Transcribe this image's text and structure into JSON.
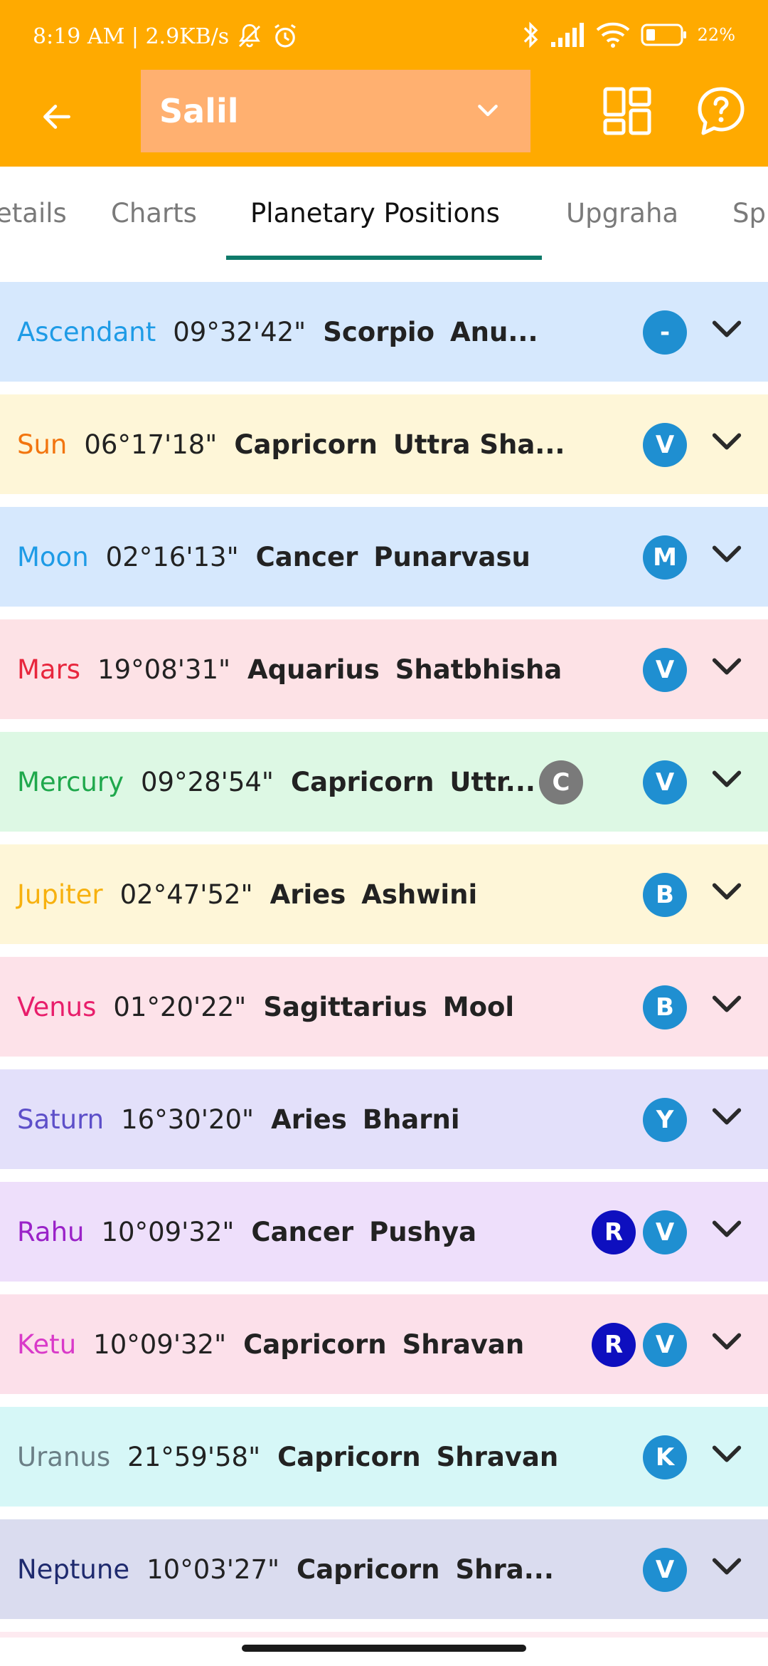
{
  "status_bar": {
    "time_and_speed": "8:19 AM | 2.9KB/s",
    "battery_percent": "22%",
    "icons": [
      "muted-bell-icon",
      "alarm-icon",
      "bluetooth-icon",
      "signal-icon",
      "wifi-icon",
      "battery-icon"
    ]
  },
  "app_bar": {
    "profile_name": "Salil",
    "icons": [
      "back-arrow-icon",
      "chevron-down-icon",
      "grid-layout-icon",
      "help-icon"
    ]
  },
  "tabs": [
    {
      "label": "etails"
    },
    {
      "label": "Charts"
    },
    {
      "label": "Planetary Positions",
      "active": true
    },
    {
      "label": "Upgraha"
    },
    {
      "label": "Sp"
    }
  ],
  "rows": [
    {
      "planet": "Ascendant",
      "degree": "09°32'42\"",
      "sign": "Scorpio",
      "nakshatra": "Anu...",
      "planet_color": "#1E9BE6",
      "bg": "#D6E8FD",
      "badges": [
        {
          "text": "-",
          "color": "#1F8FD1"
        }
      ]
    },
    {
      "planet": "Sun",
      "degree": "06°17'18\"",
      "sign": "Capricorn",
      "nakshatra": "Uttra Sha...",
      "planet_color": "#F2750F",
      "bg": "#FEF6D8",
      "badges": [
        {
          "text": "V",
          "color": "#1F8FD1"
        }
      ]
    },
    {
      "planet": "Moon",
      "degree": "02°16'13\"",
      "sign": "Cancer",
      "nakshatra": "Punarvasu",
      "planet_color": "#1E9BE6",
      "bg": "#D6E8FD",
      "badges": [
        {
          "text": "M",
          "color": "#1F8FD1"
        }
      ]
    },
    {
      "planet": "Mars",
      "degree": "19°08'31\"",
      "sign": "Aquarius",
      "nakshatra": "Shatbhisha",
      "planet_color": "#E8263D",
      "bg": "#FDE2E6",
      "badges": [
        {
          "text": "V",
          "color": "#1F8FD1"
        }
      ]
    },
    {
      "planet": "Mercury",
      "degree": "09°28'54\"",
      "sign": "Capricorn",
      "nakshatra": "Uttr...",
      "planet_color": "#1FA84C",
      "bg": "#DDF8E4",
      "badges": [
        {
          "text": "C",
          "color": "#7A7A7A"
        },
        {
          "text": "V",
          "color": "#1F8FD1"
        }
      ]
    },
    {
      "planet": "Jupiter",
      "degree": "02°47'52\"",
      "sign": "Aries",
      "nakshatra": "Ashwini",
      "planet_color": "#F7B10F",
      "bg": "#FEF6D8",
      "badges": [
        {
          "text": "B",
          "color": "#1F8FD1"
        }
      ]
    },
    {
      "planet": "Venus",
      "degree": "01°20'22\"",
      "sign": "Sagittarius",
      "nakshatra": "Mool",
      "planet_color": "#E81E6B",
      "bg": "#FDE2E9",
      "badges": [
        {
          "text": "B",
          "color": "#1F8FD1"
        }
      ]
    },
    {
      "planet": "Saturn",
      "degree": "16°30'20\"",
      "sign": "Aries",
      "nakshatra": "Bharni",
      "planet_color": "#5D4FC9",
      "bg": "#E3E0FA",
      "badges": [
        {
          "text": "Y",
          "color": "#1F8FD1"
        }
      ]
    },
    {
      "planet": "Rahu",
      "degree": "10°09'32\"",
      "sign": "Cancer",
      "nakshatra": "Pushya",
      "planet_color": "#9A22C8",
      "bg": "#EEDFFB",
      "badges": [
        {
          "text": "R",
          "color": "#0E0FBF"
        },
        {
          "text": "V",
          "color": "#1F8FD1"
        }
      ]
    },
    {
      "planet": "Ketu",
      "degree": "10°09'32\"",
      "sign": "Capricorn",
      "nakshatra": "Shravan",
      "planet_color": "#D93AC9",
      "bg": "#FCE0EA",
      "badges": [
        {
          "text": "R",
          "color": "#0E0FBF"
        },
        {
          "text": "V",
          "color": "#1F8FD1"
        }
      ]
    },
    {
      "planet": "Uranus",
      "degree": "21°59'58\"",
      "sign": "Capricorn",
      "nakshatra": "Shravan",
      "planet_color": "#6B7F86",
      "bg": "#D6F7F7",
      "badges": [
        {
          "text": "K",
          "color": "#1F8FD1"
        }
      ]
    },
    {
      "planet": "Neptune",
      "degree": "10°03'27\"",
      "sign": "Capricorn",
      "nakshatra": "Shra...",
      "planet_color": "#1E2A6E",
      "bg": "#DADCEF",
      "badges": [
        {
          "text": "V",
          "color": "#1F8FD1"
        }
      ]
    }
  ]
}
